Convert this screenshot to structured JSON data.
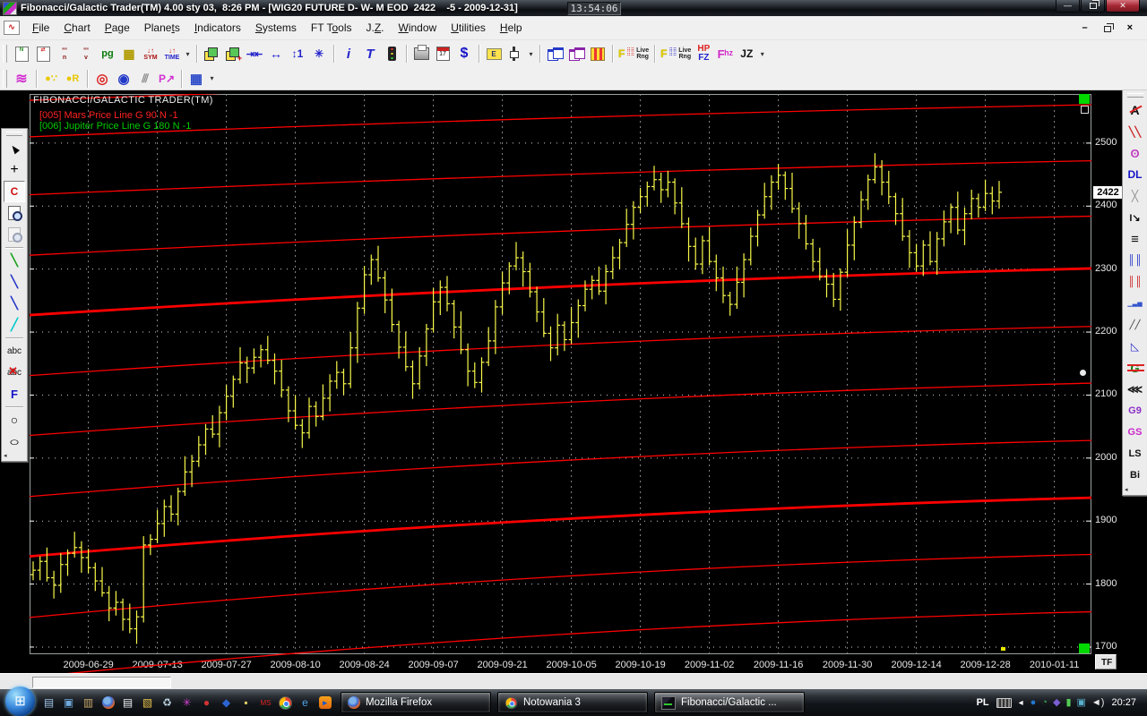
{
  "window": {
    "title": "Fibonacci/Galactic Trader(TM) 4.00 sty 03,  8:26 PM - [WIG20 FUTURE D- W- M EOD  2422    -5 - 2009-12-31]",
    "clock": "13:54:06",
    "buttons": {
      "minimize": "—",
      "restore": "",
      "close": "✕"
    }
  },
  "menu": {
    "items": [
      {
        "label": "File",
        "u": "F"
      },
      {
        "label": "Chart",
        "u": "C"
      },
      {
        "label": "Page",
        "u": "P"
      },
      {
        "label": "Planets",
        "u": "t"
      },
      {
        "label": "Indicators",
        "u": "I"
      },
      {
        "label": "Systems",
        "u": "S"
      },
      {
        "label": "FT Tools",
        "u": "o"
      },
      {
        "label": "J.Z.",
        "u": "Z"
      },
      {
        "label": "Window",
        "u": "W"
      },
      {
        "label": "Utilities",
        "u": "U"
      },
      {
        "label": "Help",
        "u": "H"
      }
    ],
    "child_minimize": "–",
    "child_close": "×"
  },
  "toolbar_main": [
    {
      "grip": true
    },
    {
      "name": "new-chart-button",
      "cls": "i-sheet",
      "t": "N",
      "c": "#1a8a1a"
    },
    {
      "name": "open-chart-button",
      "cls": "i-sheet",
      "t": "⇄",
      "c": "#c22"
    },
    {
      "name": "scale-n-button",
      "top": "ʹʹʹ",
      "ct": "#8a1a1a",
      "bot": "n",
      "cb": "#8a1a1a"
    },
    {
      "name": "scale-v-button",
      "top": "ʹʹʹ",
      "ct": "#8a1a1a",
      "bot": "v",
      "cb": "#8a1a1a"
    },
    {
      "name": "page-button",
      "t": "pg",
      "c": "#0a7a0a",
      "s": 11,
      "b": 1
    },
    {
      "name": "quote-grid-button",
      "t": "▦",
      "c": "#b09a00",
      "s": 14
    },
    {
      "name": "symbol-step-button",
      "top": "↓↑",
      "ct": "#c22",
      "bot": "SYM",
      "cb": "#a11"
    },
    {
      "name": "time-step-button",
      "top": "↓↑",
      "ct": "#c22",
      "bot": "TIME",
      "cb": "#22c"
    },
    {
      "name": "symbol-dropdown",
      "t": "▾",
      "dd": true
    },
    {
      "sep": true
    },
    {
      "name": "tile-pages-button",
      "cls": "i-stack"
    },
    {
      "name": "add-page-button",
      "cls": "i-stack",
      "plus": "+"
    },
    {
      "name": "compress-time-button",
      "t": "⇥⇤",
      "c": "#22c",
      "s": 11,
      "b": 1
    },
    {
      "name": "expand-time-button",
      "t": "↔",
      "c": "#22c",
      "s": 14,
      "b": 1
    },
    {
      "name": "scale-updown-button",
      "t": "↕1",
      "c": "#22c",
      "s": 12,
      "b": 1
    },
    {
      "name": "center-button",
      "t": "✳",
      "c": "#22c",
      "s": 12
    },
    {
      "sep": true
    },
    {
      "name": "info-button",
      "t": "i",
      "c": "#22c",
      "s": 15,
      "b": 1,
      "it": 1
    },
    {
      "name": "text-button",
      "t": "T",
      "c": "#22c",
      "s": 15,
      "b": 1,
      "it": 1
    },
    {
      "name": "signals-button",
      "cls": "i-traffic"
    },
    {
      "sep": true
    },
    {
      "name": "print-button",
      "cls": "i-printer"
    },
    {
      "name": "calendar-button",
      "cls": "i-cal",
      "t": "17"
    },
    {
      "name": "dollar-button",
      "t": "$",
      "c": "#1515c8",
      "s": 16,
      "b": 1
    },
    {
      "sep": true
    },
    {
      "name": "measure-button",
      "cls": "i-ruler",
      "t": "E"
    },
    {
      "name": "bar-style-button",
      "cls": "i-candle"
    },
    {
      "name": "bar-style-dropdown",
      "t": "▾",
      "dd": true
    },
    {
      "sep": true
    },
    {
      "name": "tile-windows-blue-button",
      "cls": "i-win",
      "cv": "#2239c8"
    },
    {
      "name": "tile-windows-purple-button",
      "cls": "i-win",
      "cv": "#8a23a8"
    },
    {
      "name": "color-grid-button",
      "cls": "i-grid"
    },
    {
      "sep": true
    },
    {
      "name": "f-live-range-red-button",
      "cls": "i-lr",
      "dc": "#d22",
      "l1": "Live",
      "l2": "Rng"
    },
    {
      "sep": true
    },
    {
      "name": "f-live-range-blue-button",
      "cls": "i-lr",
      "dc": "#22c",
      "l1": "Live",
      "l2": "Rng"
    },
    {
      "name": "hp-fz-button",
      "top": "HP",
      "ct": "#d22",
      "bot": "FZ",
      "cb": "#22c",
      "big": 1
    },
    {
      "name": "fhz-button",
      "t": "Fʰᶻ",
      "c": "#d229c9",
      "s": 13,
      "b": 1
    },
    {
      "name": "jz-button",
      "t": "JZ",
      "c": "#111",
      "s": 12,
      "b": 1
    },
    {
      "name": "jz-dropdown",
      "t": "▾",
      "dd": true
    }
  ],
  "toolbar_second": [
    {
      "grip": true
    },
    {
      "name": "biorhythm-button",
      "t": "≋",
      "c": "#d22fd2",
      "s": 16,
      "b": 1
    },
    {
      "sep": true
    },
    {
      "name": "planet-line-button",
      "t": "●∵",
      "c": "#e8c800",
      "s": 11
    },
    {
      "name": "planet-retro-button",
      "t": "●R",
      "c": "#e8c800",
      "s": 11,
      "b": 1
    },
    {
      "sep": true
    },
    {
      "name": "concentric-circles-button",
      "t": "◎",
      "c": "#d22",
      "s": 15,
      "b": 1
    },
    {
      "name": "orbit-button",
      "t": "◉",
      "c": "#2239c8",
      "s": 15
    },
    {
      "name": "angles-button",
      "t": "⫻",
      "c": "#888",
      "s": 13
    },
    {
      "name": "planet-p-button",
      "t": "P↗",
      "c": "#d22fd2",
      "s": 12,
      "b": 1
    },
    {
      "sep": true
    },
    {
      "name": "ephemeris-table-button",
      "t": "▦",
      "c": "#2a49c8",
      "s": 15
    },
    {
      "name": "ephemeris-dropdown",
      "t": "▾",
      "dd": true
    }
  ],
  "left_palette": [
    {
      "name": "pointer-tool",
      "cls": "i-cursor",
      "t": "▲"
    },
    {
      "name": "crosshair-tool",
      "t": "+",
      "c": "#000",
      "s": 16
    },
    {
      "name": "c-tool",
      "t": "C",
      "c": "#c11",
      "s": 12,
      "b": 1,
      "pressed": true
    },
    {
      "name": "zoom-in-tool",
      "cls": "i-zoom"
    },
    {
      "name": "zoom-out-tool",
      "cls": "i-zoom",
      "disabled": true
    },
    {
      "sep": true
    },
    {
      "name": "green-line-tool",
      "t": "╲",
      "c": "#14a014",
      "s": 13,
      "b": 1
    },
    {
      "name": "blue-line-tool",
      "t": "╲",
      "c": "#2233c8",
      "s": 13,
      "b": 1
    },
    {
      "name": "steep-line-tool",
      "t": "╲",
      "c": "#2233c8",
      "s": 13,
      "b": 1
    },
    {
      "name": "pencil-tool",
      "t": "╱",
      "c": "#00c8c8",
      "s": 13,
      "b": 1
    },
    {
      "sep": true
    },
    {
      "name": "text-label-tool",
      "t": "abc",
      "c": "#111",
      "s": 10
    },
    {
      "name": "delete-text-tool",
      "t": "abc",
      "c": "#111",
      "s": 10,
      "cls": "i-xred"
    },
    {
      "name": "fibonacci-tool",
      "t": "F",
      "c": "#1515c8",
      "s": 13,
      "b": 1
    },
    {
      "sep": true
    },
    {
      "name": "circle-tool",
      "t": "○",
      "c": "#000",
      "s": 14
    },
    {
      "name": "ellipse-tool",
      "t": "○",
      "c": "#000",
      "s": 13,
      "cls": "i-ellipse"
    },
    {
      "name": "collapse-left-palette",
      "arrow": "◂"
    }
  ],
  "right_palette": [
    {
      "name": "astro-a-tool",
      "t": "A",
      "c": "#111",
      "s": 14,
      "b": 1,
      "cls": "i-A"
    },
    {
      "name": "trend-pens-tool",
      "t": "╲╲",
      "c": "#c22",
      "s": 11,
      "b": 1
    },
    {
      "name": "cycle-circles-tool",
      "t": "ʘ",
      "c": "#c23fc2",
      "s": 13,
      "b": 1
    },
    {
      "name": "dl-tool",
      "t": "DL",
      "c": "#1515c8",
      "s": 12,
      "b": 1
    },
    {
      "name": "cross-lines-tool",
      "t": "╳",
      "c": "#909090",
      "s": 12
    },
    {
      "name": "i-trend-tool",
      "t": "I↘",
      "c": "#111",
      "s": 11,
      "b": 1
    },
    {
      "name": "h-lines-tool",
      "t": "≡",
      "c": "#111",
      "s": 15,
      "b": 1
    },
    {
      "name": "v-lines-blue-tool",
      "t": "║║",
      "c": "#2233c8",
      "s": 11,
      "b": 1
    },
    {
      "name": "v-lines-red-tool",
      "t": "║║",
      "c": "#c22",
      "s": 11,
      "b": 1
    },
    {
      "name": "mini-bars-tool",
      "t": "▁▃▅",
      "c": "#3355cc",
      "s": 7
    },
    {
      "name": "parallel-lines-tool",
      "t": "╱╱",
      "c": "#333",
      "s": 10
    },
    {
      "name": "triangle-tool",
      "t": "◺",
      "c": "#3333cc",
      "s": 12
    },
    {
      "name": "gann-g-tool",
      "t": "G",
      "c": "#0a7a0a",
      "s": 13,
      "b": 1,
      "cls": "i-G"
    },
    {
      "name": "fan-arrows-tool",
      "t": "⋘",
      "c": "#111",
      "s": 12,
      "b": 1
    },
    {
      "name": "g9-tool",
      "t": "G9",
      "c": "#8b2fc9",
      "s": 11,
      "b": 1
    },
    {
      "name": "gs-tool",
      "t": "GS",
      "c": "#c929c9",
      "s": 11,
      "b": 1
    },
    {
      "name": "ls-tool",
      "t": "LS",
      "c": "#111",
      "s": 11,
      "b": 1
    },
    {
      "name": "bi-tool",
      "t": "Bi",
      "c": "#111",
      "s": 11,
      "b": 1
    },
    {
      "name": "collapse-right-palette",
      "arrow": "◂"
    }
  ],
  "chart": {
    "watermark": "FIBONACCI/GALACTIC TRADER(TM)",
    "tf_button": "TF",
    "accent_bar_color": "#f8f84a",
    "grid_v_color": "#8a8a8a",
    "grid_h_color": "#d0d0d0",
    "line_color": "#ff0000",
    "marker_green": "#00d800",
    "marker_yellow": "#e8e800"
  },
  "chart_data": {
    "type": "ohlc-bar",
    "title": "WIG20 FUTURE D- W- M EOD",
    "last_close": 2422,
    "change": -5,
    "last_date": "2009-12-31",
    "legend": [
      {
        "text": "[005] Mars Price Line G 90 N -1",
        "color": "#ff2222"
      },
      {
        "text": "[006] Jupiter Price Line G 180 N -1",
        "color": "#00cc00"
      }
    ],
    "ylim": [
      1690,
      2578
    ],
    "y_ticks": [
      2500,
      2400,
      2300,
      2200,
      2100,
      2000,
      1900,
      1800,
      1700
    ],
    "x_labels": [
      "2009-06-29",
      "2009-07-13",
      "2009-07-27",
      "2009-08-10",
      "2009-08-24",
      "2009-09-07",
      "2009-09-21",
      "2009-10-05",
      "2009-10-19",
      "2009-11-02",
      "2009-11-16",
      "2009-11-30",
      "2009-12-14",
      "2009-12-28",
      "2010-01-11"
    ],
    "x_label_bar_indices": [
      8,
      18,
      28,
      38,
      48,
      58,
      68,
      78,
      88,
      98,
      108,
      118,
      128,
      138,
      148
    ],
    "first_open": 1815,
    "closes": [
      1822,
      1836,
      1810,
      1798,
      1831,
      1849,
      1858,
      1842,
      1826,
      1805,
      1786,
      1762,
      1771,
      1744,
      1729,
      1748,
      1862,
      1871,
      1896,
      1923,
      1911,
      1947,
      1978,
      1995,
      2021,
      2046,
      2038,
      2072,
      2098,
      2125,
      2151,
      2143,
      2160,
      2172,
      2155,
      2138,
      2108,
      2075,
      2052,
      2040,
      2082,
      2066,
      2095,
      2122,
      2136,
      2118,
      2175,
      2238,
      2291,
      2315,
      2286,
      2251,
      2212,
      2176,
      2145,
      2118,
      2162,
      2205,
      2248,
      2271,
      2245,
      2208,
      2172,
      2138,
      2120,
      2152,
      2186,
      2240,
      2278,
      2305,
      2318,
      2296,
      2264,
      2232,
      2198,
      2175,
      2211,
      2188,
      2215,
      2242,
      2268,
      2282,
      2265,
      2296,
      2318,
      2342,
      2371,
      2398,
      2415,
      2431,
      2442,
      2426,
      2438,
      2405,
      2372,
      2336,
      2308,
      2345,
      2312,
      2286,
      2258,
      2244,
      2279,
      2315,
      2352,
      2386,
      2415,
      2438,
      2449,
      2428,
      2396,
      2372,
      2340,
      2312,
      2288,
      2276,
      2252,
      2295,
      2338,
      2374,
      2410,
      2442,
      2462,
      2438,
      2415,
      2388,
      2352,
      2326,
      2305,
      2338,
      2312,
      2348,
      2375,
      2398,
      2362,
      2388,
      2412,
      2398,
      2420,
      2408,
      2422
    ],
    "bar_high_pad": [
      14,
      8,
      22,
      11,
      18,
      6,
      25,
      10
    ],
    "bar_low_pad": [
      9,
      16,
      6,
      21,
      12,
      18,
      7,
      24
    ],
    "red_lines": [
      {
        "start": 2568,
        "mid": 2598,
        "end": 2628,
        "thick": false
      },
      {
        "start": 2510,
        "mid": 2540,
        "end": 2561,
        "thick": false
      },
      {
        "start": 2418,
        "mid": 2450,
        "end": 2472,
        "thick": false
      },
      {
        "start": 2322,
        "mid": 2360,
        "end": 2384,
        "thick": false
      },
      {
        "start": 2227,
        "mid": 2272,
        "end": 2301,
        "thick": true
      },
      {
        "start": 2131,
        "mid": 2180,
        "end": 2209,
        "thick": false
      },
      {
        "start": 2036,
        "mid": 2088,
        "end": 2119,
        "thick": false
      },
      {
        "start": 1939,
        "mid": 1996,
        "end": 2028,
        "thick": false
      },
      {
        "start": 1844,
        "mid": 1903,
        "end": 1937,
        "thick": true
      },
      {
        "start": 1747,
        "mid": 1812,
        "end": 1847,
        "thick": false
      },
      {
        "start": 1652,
        "mid": 1720,
        "end": 1756,
        "thick": false
      }
    ],
    "price_tag": "2422"
  },
  "taskbar": {
    "quick_launch": [
      {
        "name": "show-desktop-icon",
        "t": "▤",
        "c": "#9fc5e8"
      },
      {
        "name": "switch-windows-icon",
        "t": "▣",
        "c": "#6fa8dc"
      },
      {
        "name": "save-drive-icon",
        "t": "▥",
        "c": "#c9a96a"
      },
      {
        "name": "firefox-icon",
        "cls": "i-ff"
      },
      {
        "name": "notepad-icon",
        "t": "▤",
        "c": "#eef3f6"
      },
      {
        "name": "folder-icon",
        "t": "▧",
        "c": "#e8c34a"
      },
      {
        "name": "recycle-bin-icon",
        "t": "♻",
        "c": "#bcd3e0"
      },
      {
        "name": "graphics-app-icon",
        "t": "✳",
        "c": "#d23fd2"
      },
      {
        "name": "security-app-icon",
        "t": "●",
        "c": "#d23434"
      },
      {
        "name": "messenger-icon",
        "t": "◆",
        "c": "#2d64d2"
      },
      {
        "name": "docs-app-icon",
        "t": "▪",
        "c": "#e0cc66"
      },
      {
        "name": "ms-app-icon",
        "t": "MS",
        "c": "#d22"
      },
      {
        "name": "chrome-icon",
        "cls": "i-chrome"
      },
      {
        "name": "internet-explorer-icon",
        "t": "e",
        "c": "#4fa3e8"
      },
      {
        "name": "media-player-icon",
        "cls": "i-media",
        "t": "▸"
      }
    ],
    "buttons": [
      {
        "name": "taskbar-button-firefox",
        "label": "Mozilla Firefox",
        "icon": "i-ff",
        "active": false
      },
      {
        "name": "taskbar-button-notowania",
        "label": "Notowania 3",
        "icon": "i-chrome",
        "active": false
      },
      {
        "name": "taskbar-button-fibonacci",
        "label": "Fibonacci/Galactic ...",
        "icon": "i-fib",
        "active": true
      }
    ],
    "tray": {
      "lang": "PL",
      "chevron": "◂",
      "icons": [
        {
          "name": "tray-app-blue-icon",
          "t": "●",
          "c": "#2277cc"
        },
        {
          "name": "tray-scheduler-icon",
          "t": "◔",
          "c": "#3aa655"
        },
        {
          "name": "tray-gamepad-icon",
          "t": "◆",
          "c": "#7a5fd2"
        },
        {
          "name": "tray-power-icon",
          "t": "▮",
          "c": "#55cc55"
        },
        {
          "name": "tray-network-icon",
          "t": "▣",
          "c": "#58b0cc"
        },
        {
          "name": "tray-volume-icon",
          "t": "◄)",
          "c": "#e8e8e8"
        }
      ],
      "clock": "20:27"
    }
  },
  "status_bar": {
    "message": ""
  }
}
